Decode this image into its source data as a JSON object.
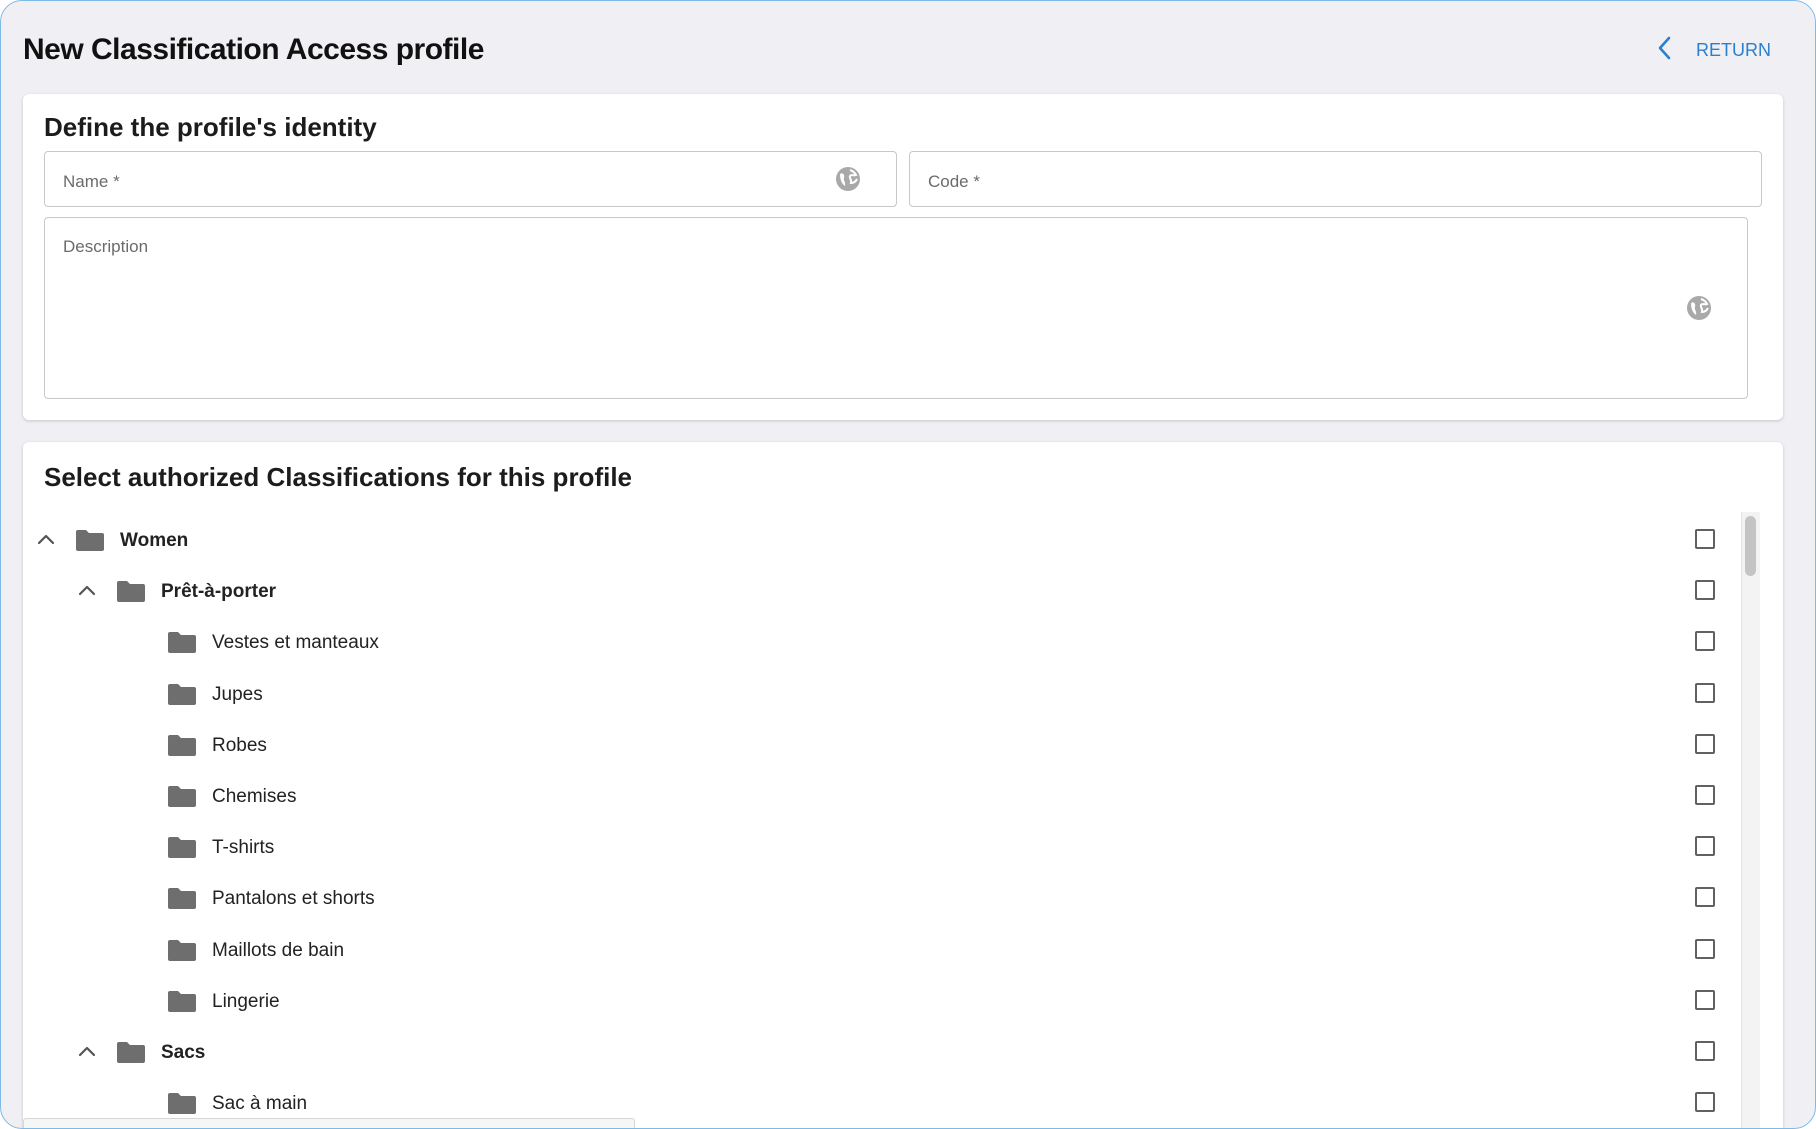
{
  "header": {
    "title": "New Classification Access profile",
    "return_label": "RETURN",
    "return_icon": "chevron-left-icon"
  },
  "identity": {
    "title": "Define the profile's identity",
    "name_label": "Name *",
    "code_label": "Code *",
    "description_label": "Description",
    "globe_icon": "globe-icon"
  },
  "classifications": {
    "title": "Select authorized Classifications for this profile",
    "rows": [
      {
        "label": "Women",
        "level": 0,
        "expandable": true,
        "expanded": true,
        "bold": true,
        "checked": false
      },
      {
        "label": "Prêt-à-porter",
        "level": 1,
        "expandable": true,
        "expanded": true,
        "bold": true,
        "checked": false
      },
      {
        "label": "Vestes et manteaux",
        "level": 2,
        "expandable": false,
        "bold": false,
        "checked": false
      },
      {
        "label": "Jupes",
        "level": 2,
        "expandable": false,
        "bold": false,
        "checked": false
      },
      {
        "label": "Robes",
        "level": 2,
        "expandable": false,
        "bold": false,
        "checked": false
      },
      {
        "label": "Chemises",
        "level": 2,
        "expandable": false,
        "bold": false,
        "checked": false
      },
      {
        "label": "T-shirts",
        "level": 2,
        "expandable": false,
        "bold": false,
        "checked": false
      },
      {
        "label": "Pantalons et shorts",
        "level": 2,
        "expandable": false,
        "bold": false,
        "checked": false
      },
      {
        "label": "Maillots de bain",
        "level": 2,
        "expandable": false,
        "bold": false,
        "checked": false
      },
      {
        "label": "Lingerie",
        "level": 2,
        "expandable": false,
        "bold": false,
        "checked": false
      },
      {
        "label": "Sacs",
        "level": 1,
        "expandable": true,
        "expanded": true,
        "bold": true,
        "checked": false
      },
      {
        "label": "Sac à main",
        "level": 2,
        "expandable": false,
        "bold": false,
        "checked": false
      }
    ]
  },
  "colors": {
    "accent": "#2a7fcf",
    "folder": "#6e6e6e",
    "background": "#f0f0f4"
  }
}
